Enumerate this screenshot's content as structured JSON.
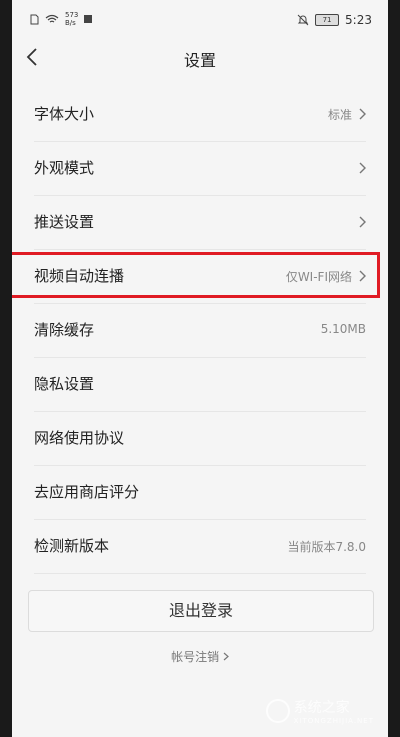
{
  "statusbar": {
    "speed_top": "573",
    "speed_bottom": "B/s",
    "battery": "71",
    "time": "5:23"
  },
  "header": {
    "title": "设置"
  },
  "settings": [
    {
      "label": "字体大小",
      "value": "标准"
    },
    {
      "label": "外观模式",
      "value": ""
    },
    {
      "label": "推送设置",
      "value": ""
    },
    {
      "label": "视频自动连播",
      "value": "仅WI-FI网络"
    },
    {
      "label": "清除缓存",
      "value": "5.10MB"
    },
    {
      "label": "隐私设置",
      "value": ""
    },
    {
      "label": "网络使用协议",
      "value": ""
    },
    {
      "label": "去应用商店评分",
      "value": ""
    },
    {
      "label": "检测新版本",
      "value": "当前版本7.8.0"
    }
  ],
  "logout_label": "退出登录",
  "cancel_account_label": "帐号注销",
  "watermark": {
    "main": "系统之家",
    "sub": "XITONGZHIJIA.NET"
  },
  "colors": {
    "highlight": "#e01b24",
    "background": "#f5f5f5"
  }
}
